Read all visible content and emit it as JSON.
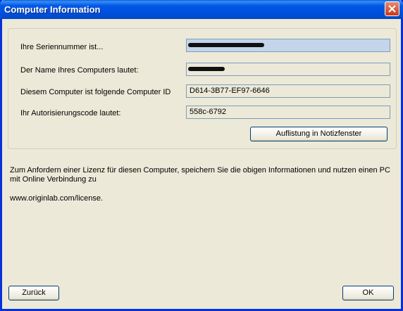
{
  "window": {
    "title": "Computer Information"
  },
  "fields": [
    {
      "label": "Ihre Seriennummer ist...",
      "value": "",
      "redacted": true
    },
    {
      "label": "Der Name Ihres Computers lautet:",
      "value": "",
      "redacted": true
    },
    {
      "label": "Diesem Computer ist folgende Computer ID",
      "value": "D614-3B77-EF97-6646",
      "redacted": false
    },
    {
      "label": "Ihr Autorisierungscode lautet:",
      "value": "558c-6792",
      "redacted": false
    }
  ],
  "buttons": {
    "list_in_notepad": "Auflistung in Notizfenster",
    "back": "Zurück",
    "ok": "OK"
  },
  "info": {
    "text": "Zum Anfordern einer Lizenz für diesen Computer, speichern Sie die obigen Informationen und nutzen einen PC mit Online Verbindung zu",
    "url": "www.originlab.com/license."
  }
}
